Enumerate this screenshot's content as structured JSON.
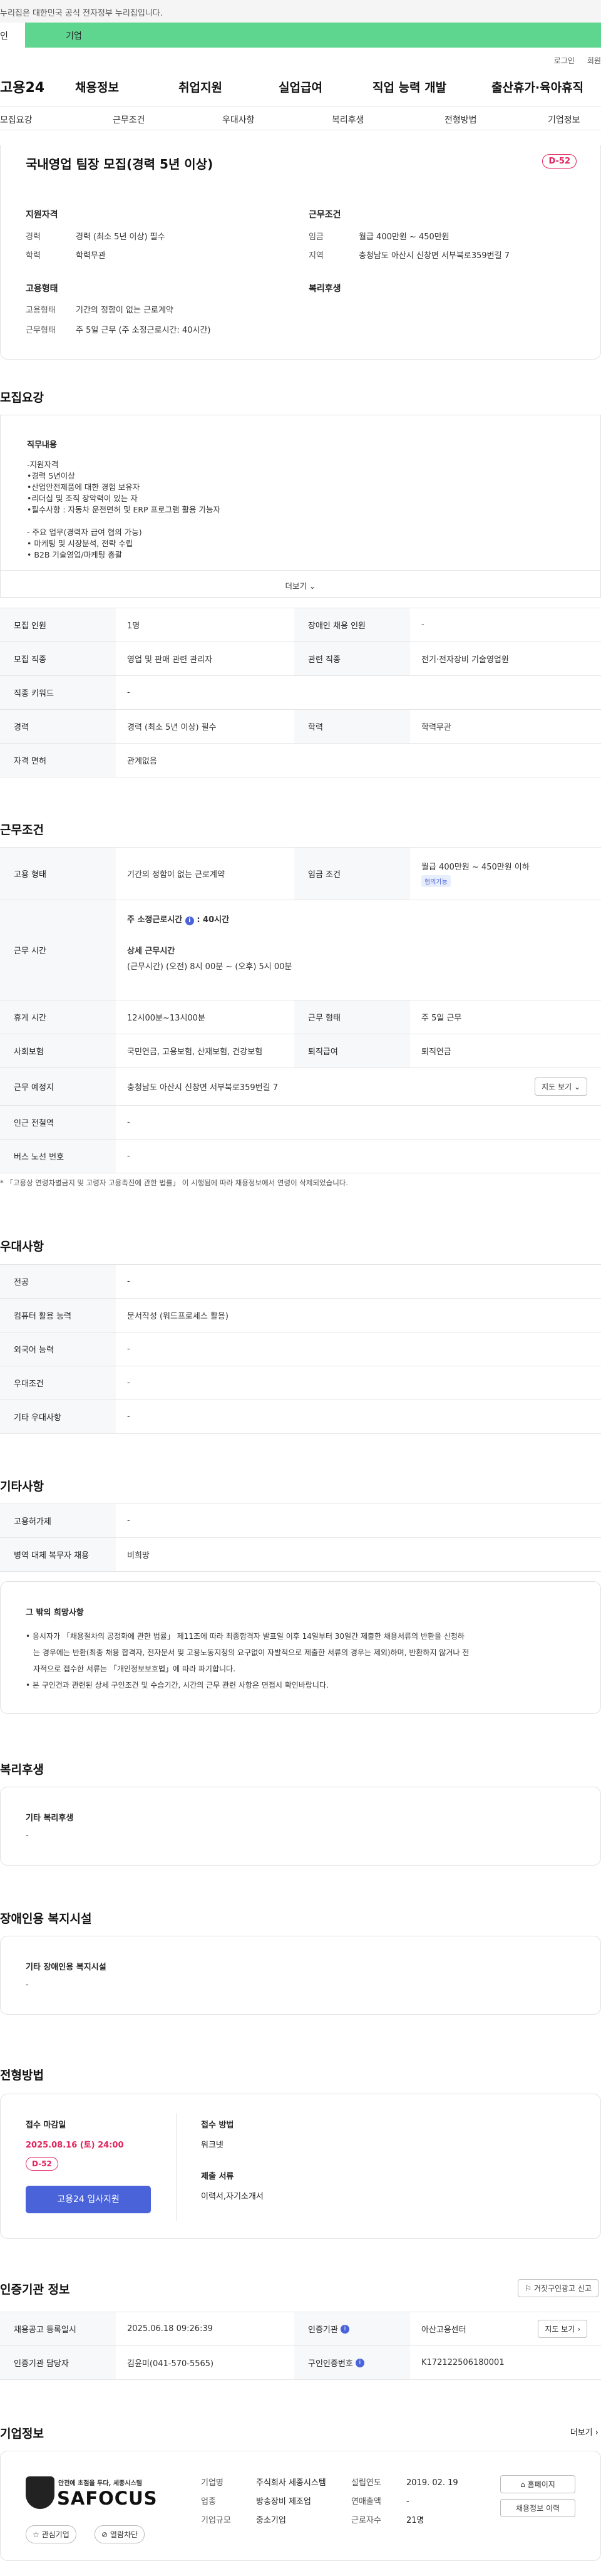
{
  "topnote": "누리집은 대한민국 공식 전자정부 누리집입니다.",
  "top_tabs": {
    "person": "인",
    "company": "기업"
  },
  "util": {
    "login": "로그인",
    "signup": "회원"
  },
  "gnb": {
    "logo": "고용24",
    "items": [
      "채용정보",
      "취업지원",
      "실업급여",
      "직업 능력 개발",
      "출산휴가·육아휴직"
    ]
  },
  "subnav": [
    "모집요강",
    "근무조건",
    "우대사항",
    "복리후생",
    "전형방법",
    "기업정보"
  ],
  "job": {
    "title": "국내영업 팀장 모집(경력 5년 이상)",
    "dday": "D-52",
    "qual_title": "지원자격",
    "qual": [
      {
        "k": "경력",
        "v": "경력 (최소 5년 이상) 필수"
      },
      {
        "k": "학력",
        "v": "학력무관"
      }
    ],
    "cond_title": "근무조건",
    "cond": [
      {
        "k": "임금",
        "v": "월급 400만원 ~ 450만원"
      },
      {
        "k": "지역",
        "v": "충청남도 아산시 신창면 서부북로359번길 7"
      }
    ],
    "emp_title": "고용형태",
    "emp": [
      {
        "k": "고용형태",
        "v": "기간의 정함이 없는 근로계약"
      },
      {
        "k": "근무형태",
        "v": "주 5일 근무 (주 소정근로시간: 40시간)"
      }
    ],
    "welfare_title": "복리후생"
  },
  "recruit": {
    "title": "모집요강",
    "duty_title": "직무내용",
    "duty_lines": [
      "-지원자격",
      "•경력 5년이상",
      "•산업안전제품에 대한 경험 보유자",
      "•리더십 및 조직 장악력이 있는 자",
      "•필수사항 : 자동차 운전면허 및 ERP 프로그램 활용 가능자",
      "",
      "- 주요 업무(경력자 급여 협의 가능)",
      "• 마케팅 및 시장분석, 전략 수립",
      "• B2B 기술영업/마케팅 총괄"
    ],
    "more": "더보기",
    "rows": [
      [
        "모집 인원",
        "1명",
        "장애인 채용 인원",
        "-"
      ],
      [
        "모집 직종",
        "영업 및 판매 관련 관리자",
        "관련 직종",
        "전기·전자장비 기술영업원"
      ],
      [
        "직종 키워드",
        "-"
      ],
      [
        "경력",
        "경력 (최소 5년 이상) 필수",
        "학력",
        "학력무관"
      ],
      [
        "자격 면허",
        "관계없음"
      ]
    ]
  },
  "work": {
    "title": "근무조건",
    "emp_type_k": "고용 형태",
    "emp_type_v": "기간의 정함이 없는 근로계약",
    "wage_k": "임금 조건",
    "wage_v": "월급 400만원 ~ 450만원 이하",
    "wage_pill": "협의가능",
    "hours_k": "근무 시간",
    "hours_week": "주 소정근로시간",
    "hours_week_v": ": 40시간",
    "hours_detail_t": "상세 근무시간",
    "hours_detail_v": "(근무시간) (오전) 8시 00분 ~ (오후) 5시 00분",
    "rest_k": "휴게 시간",
    "rest_v": "12시00분~13시00분",
    "form_k": "근무 형태",
    "form_v": "주 5일 근무",
    "ins_k": "사회보험",
    "ins_v": "국민연금, 고용보험, 산재보험, 건강보험",
    "sev_k": "퇴직급여",
    "sev_v": "퇴직연금",
    "place_k": "근무 예정지",
    "place_v": "충청남도 아산시 신창면 서부북로359번길 7",
    "map": "지도 보기",
    "sub_k": "인근 전철역",
    "sub_v": "-",
    "bus_k": "버스 노선 번호",
    "bus_v": "-",
    "note": "* 「고용상 연령차별금지 및 고령자 고용촉진에 관한 법률」 이 시행됨에 따라 채용정보에서 연령이 삭제되었습니다."
  },
  "pref": {
    "title": "우대사항",
    "rows": [
      [
        "전공",
        "-"
      ],
      [
        "컴퓨터 활용 능력",
        "문서작성 (워드프로세스 활용)"
      ],
      [
        "외국어 능력",
        "-"
      ],
      [
        "우대조건",
        "-"
      ],
      [
        "기타 우대사항",
        "-"
      ]
    ]
  },
  "etc": {
    "title": "기타사항",
    "rows": [
      [
        "고용허가제",
        "-"
      ],
      [
        "병역 대체 복무자 채용",
        "비희망"
      ]
    ],
    "box_title": "그 밖의 희망사항",
    "box_lines": [
      "• 응시자가 「채용절차의 공정화에 관한 법률」 제11조에 따라 최종합격자 발표일 이후 14일부터 30일간 제출한 채용서류의 반환을 신청하",
      "는 경우에는 반환(최종 채용 합격자, 전자문서 및 고용노동지청의 요구없이 자발적으로 제출한 서류의 경우는 제외)하며, 반환하지 않거나 전",
      "자적으로 접수한 서류는 「개인정보보호법」에 따라 파기합니다.",
      "• 본 구인건과 관련된 상세 구인조건 및 수습기간, 시간의 근무 관련 사항은 면접시 확인바랍니다."
    ]
  },
  "welfare": {
    "title": "복리후생",
    "box_title": "기타 복리후생",
    "box_val": "-"
  },
  "disab": {
    "title": "장애인용 복지시설",
    "box_title": "기타 장애인용 복지시설",
    "box_val": "-"
  },
  "screening": {
    "title": "전형방법",
    "deadline_t": "접수 마감일",
    "deadline_v": "2025.08.16 (토) 24:00",
    "dday": "D-52",
    "apply": "고용24 입사지원",
    "method_t": "접수 방법",
    "method_v": "워크넷",
    "docs_t": "제출 서류",
    "docs_v": "이력서,자기소개서"
  },
  "cert": {
    "title": "인증기관 정보",
    "report": "거짓구인광고 신고",
    "rows": [
      [
        "채용공고 등록일시",
        "2025.06.18 09:26:39",
        "인증기관",
        "아산고용센터"
      ],
      [
        "인증기관 담당자",
        "김윤미(041-570-5565)",
        "구인인증번호",
        "K172122506180001"
      ]
    ],
    "map": "지도 보기"
  },
  "company": {
    "title": "기업정보",
    "more": "더보기",
    "logo_top": "안전에 초점을 두다, 세종시스템",
    "logo_main": "SAFOCUS",
    "like": "관심기업",
    "block": "열람차단",
    "fields": [
      [
        "기업명",
        "주식회사 세종시스템"
      ],
      [
        "업종",
        "방송장비 제조업"
      ],
      [
        "기업규모",
        "중소기업"
      ]
    ],
    "fields2": [
      [
        "설립연도",
        "2019. 02. 19"
      ],
      [
        "연매출액",
        "-"
      ],
      [
        "근로자수",
        "21명"
      ]
    ],
    "home": "홈페이지",
    "jobs": "채용정보 이력"
  }
}
